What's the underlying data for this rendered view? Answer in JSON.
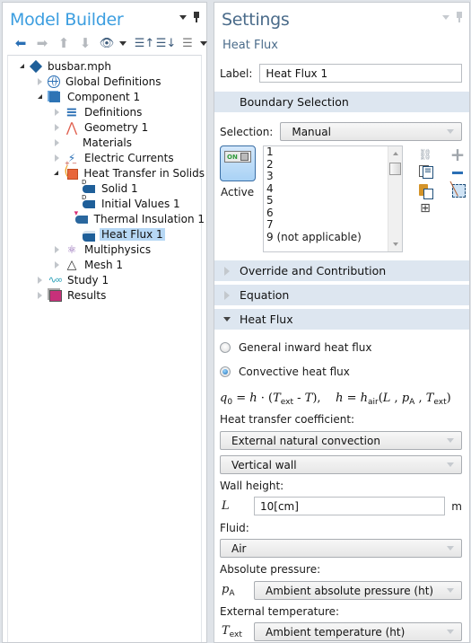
{
  "model_builder": {
    "title": "Model Builder",
    "toolbar": [
      {
        "name": "back-arrow-icon",
        "glyph": "🡐"
      },
      {
        "name": "forward-arrow-icon",
        "glyph": "🡒"
      },
      {
        "name": "move-up-icon",
        "glyph": "🡑"
      },
      {
        "name": "move-down-icon",
        "glyph": "🡓"
      }
    ],
    "tree": {
      "root": "busbar.mph",
      "global_definitions": "Global Definitions",
      "component": "Component 1",
      "definitions": "Definitions",
      "geometry": "Geometry 1",
      "materials": "Materials",
      "electric_currents": "Electric Currents",
      "heat_transfer": "Heat Transfer in Solids",
      "solid": "Solid 1",
      "initial_values": "Initial Values 1",
      "thermal_insulation": "Thermal Insulation 1",
      "heat_flux": "Heat Flux 1",
      "multiphysics": "Multiphysics",
      "mesh": "Mesh 1",
      "study": "Study 1",
      "results": "Results"
    },
    "selected_node": "Heat Flux 1"
  },
  "settings": {
    "title": "Settings",
    "subtitle": "Heat Flux",
    "label_caption": "Label:",
    "label_value": "Heat Flux 1",
    "sections": {
      "boundary_selection": "Boundary Selection",
      "override": "Override and Contribution",
      "equation": "Equation",
      "heat_flux": "Heat Flux"
    },
    "selection_caption": "Selection:",
    "selection_value": "Manual",
    "active_switch": "ON",
    "active_label": "Active",
    "boundaries": [
      "1",
      "2",
      "3",
      "4",
      "5",
      "6",
      "7",
      "9 (not applicable)"
    ],
    "radio_general": "General inward heat flux",
    "radio_convective": "Convective heat flux",
    "selected_radio": "Convective heat flux",
    "htc_caption": "Heat transfer coefficient:",
    "htc_value": "External natural convection",
    "geometry_value": "Vertical wall",
    "wall_height_caption": "Wall height:",
    "wall_height_symbol": "L",
    "wall_height_value": "10[cm]",
    "wall_height_unit": "m",
    "fluid_caption": "Fluid:",
    "fluid_value": "Air",
    "pressure_caption": "Absolute pressure:",
    "pressure_symbol": "p",
    "pressure_sub": "A",
    "pressure_value": "Ambient absolute pressure (ht)",
    "temp_caption": "External temperature:",
    "temp_symbol": "T",
    "temp_sub": "ext",
    "temp_value": "Ambient temperature (ht)"
  }
}
